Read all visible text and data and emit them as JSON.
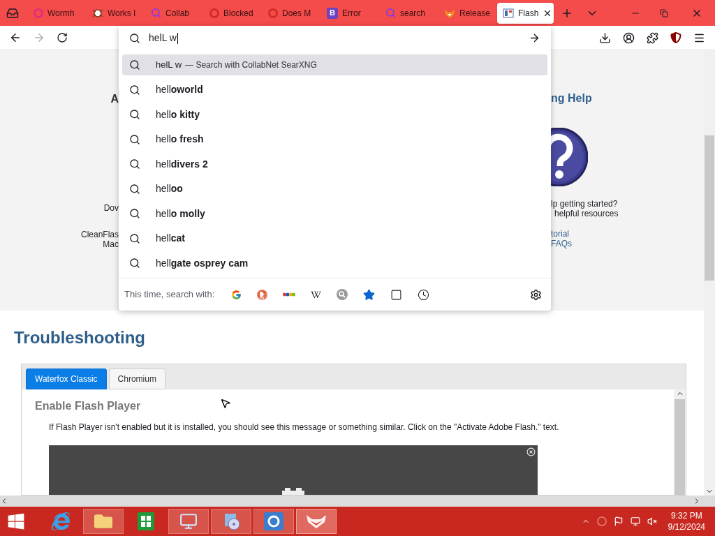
{
  "browser_tabs": [
    {
      "title": "Wormh",
      "selected": false,
      "kind": "ring-magenta"
    },
    {
      "title": "Works I",
      "selected": false,
      "kind": "bug"
    },
    {
      "title": "Collab",
      "selected": false,
      "kind": "search"
    },
    {
      "title": "Blocked",
      "selected": false,
      "kind": "ring-red"
    },
    {
      "title": "Does M",
      "selected": false,
      "kind": "ring-red"
    },
    {
      "title": "Error",
      "selected": false,
      "kind": "letter",
      "icon_text": "B"
    },
    {
      "title": "search",
      "selected": false,
      "kind": "search"
    },
    {
      "title": "Release",
      "selected": false,
      "kind": "fox"
    },
    {
      "title": "Flash",
      "selected": true,
      "kind": "page"
    }
  ],
  "address_bar": {
    "value": "helL w"
  },
  "suggestions": [
    {
      "kind": "search-with",
      "query": "helL w",
      "label": "— Search with CollabNet SearXNG",
      "selected": true
    },
    {
      "kind": "suggestion",
      "text": "hell**oworld**",
      "selected": false
    },
    {
      "kind": "suggestion",
      "text": "hell**o kitty**",
      "selected": false
    },
    {
      "kind": "suggestion",
      "text": "hell**o fresh**",
      "selected": false
    },
    {
      "kind": "suggestion",
      "text": "hell**divers 2**",
      "selected": false
    },
    {
      "kind": "suggestion",
      "text": "hell**oo**",
      "selected": false
    },
    {
      "kind": "suggestion",
      "text": "hell**o molly**",
      "selected": false
    },
    {
      "kind": "suggestion",
      "text": "hell**cat**",
      "selected": false
    },
    {
      "kind": "suggestion",
      "text": "hell**gate osprey cam**",
      "selected": false
    }
  ],
  "search_with": {
    "label": "This time, search with:",
    "engines": [
      {
        "kind": "google"
      },
      {
        "kind": "duckduckgo"
      },
      {
        "kind": "ebay"
      },
      {
        "kind": "wikipedia"
      },
      {
        "kind": "searx"
      },
      {
        "kind": "bookmarks"
      },
      {
        "kind": "tabs"
      },
      {
        "kind": "history"
      }
    ]
  },
  "page": {
    "left_heading": "A",
    "left_texts": [
      "Dov"
    ],
    "left_links": [
      "CleanFlas",
      "Mac"
    ],
    "right_heading": "ng Help",
    "right_texts": [
      "lp getting started?",
      "helpful resources"
    ],
    "right_links": [
      "torial",
      "FAQs"
    ]
  },
  "troubleshooting": {
    "title": "Troubleshooting",
    "tabs": [
      {
        "label": "Waterfox Classic",
        "selected": true
      },
      {
        "label": "Chromium",
        "selected": false
      }
    ],
    "heading": "Enable Flash Player",
    "text": "If Flash Player isn't enabled but it is installed, you should see this message or something similar. Click on the \"Activate Adobe Flash.\" text."
  },
  "taskbar": {
    "apps": [
      {
        "kind": "ie",
        "selected": false
      },
      {
        "kind": "folder",
        "selected": false
      },
      {
        "kind": "store",
        "selected": false
      },
      {
        "kind": "control",
        "selected": false
      },
      {
        "kind": "disc",
        "selected": false
      },
      {
        "kind": "tile",
        "selected": false
      },
      {
        "kind": "fox",
        "selected": true
      }
    ],
    "time": "9:32 PM",
    "date": "9/12/2024"
  }
}
